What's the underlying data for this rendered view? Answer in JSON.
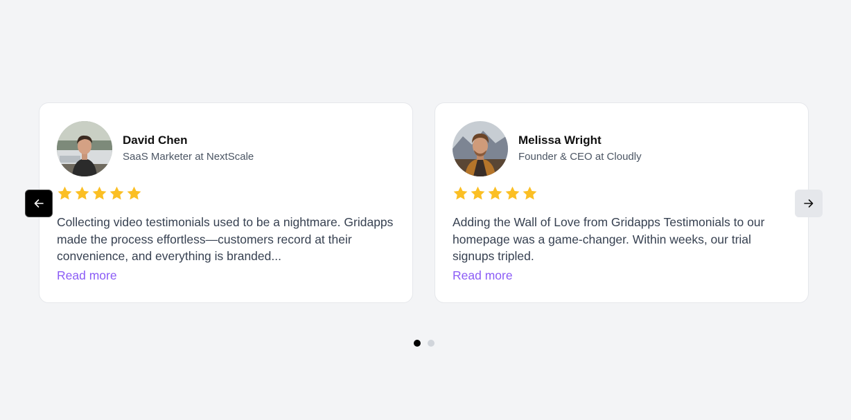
{
  "colors": {
    "background": "#f3f4f6",
    "card": "#ffffff",
    "star": "#fbbf24",
    "link": "#8b5cf6",
    "dot_active": "#000000",
    "dot_inactive": "#d1d5db"
  },
  "testimonials": [
    {
      "name": "David Chen",
      "role": "SaaS Marketer at NextScale",
      "rating": 5,
      "text": "Collecting video testimonials used to be a nightmare. Gridapps made the process effortless—customers record at their convenience, and everything is branded...",
      "read_more": "Read more"
    },
    {
      "name": "Melissa Wright",
      "role": "Founder & CEO at Cloudly",
      "rating": 5,
      "text": "Adding the Wall of Love from Gridapps Testimonials to our homepage was a game-changer. Within weeks, our trial signups tripled.",
      "read_more": "Read more"
    }
  ],
  "navigation": {
    "prev_icon": "arrow-left-icon",
    "next_icon": "arrow-right-icon"
  },
  "pagination": {
    "total": 2,
    "active": 1
  }
}
